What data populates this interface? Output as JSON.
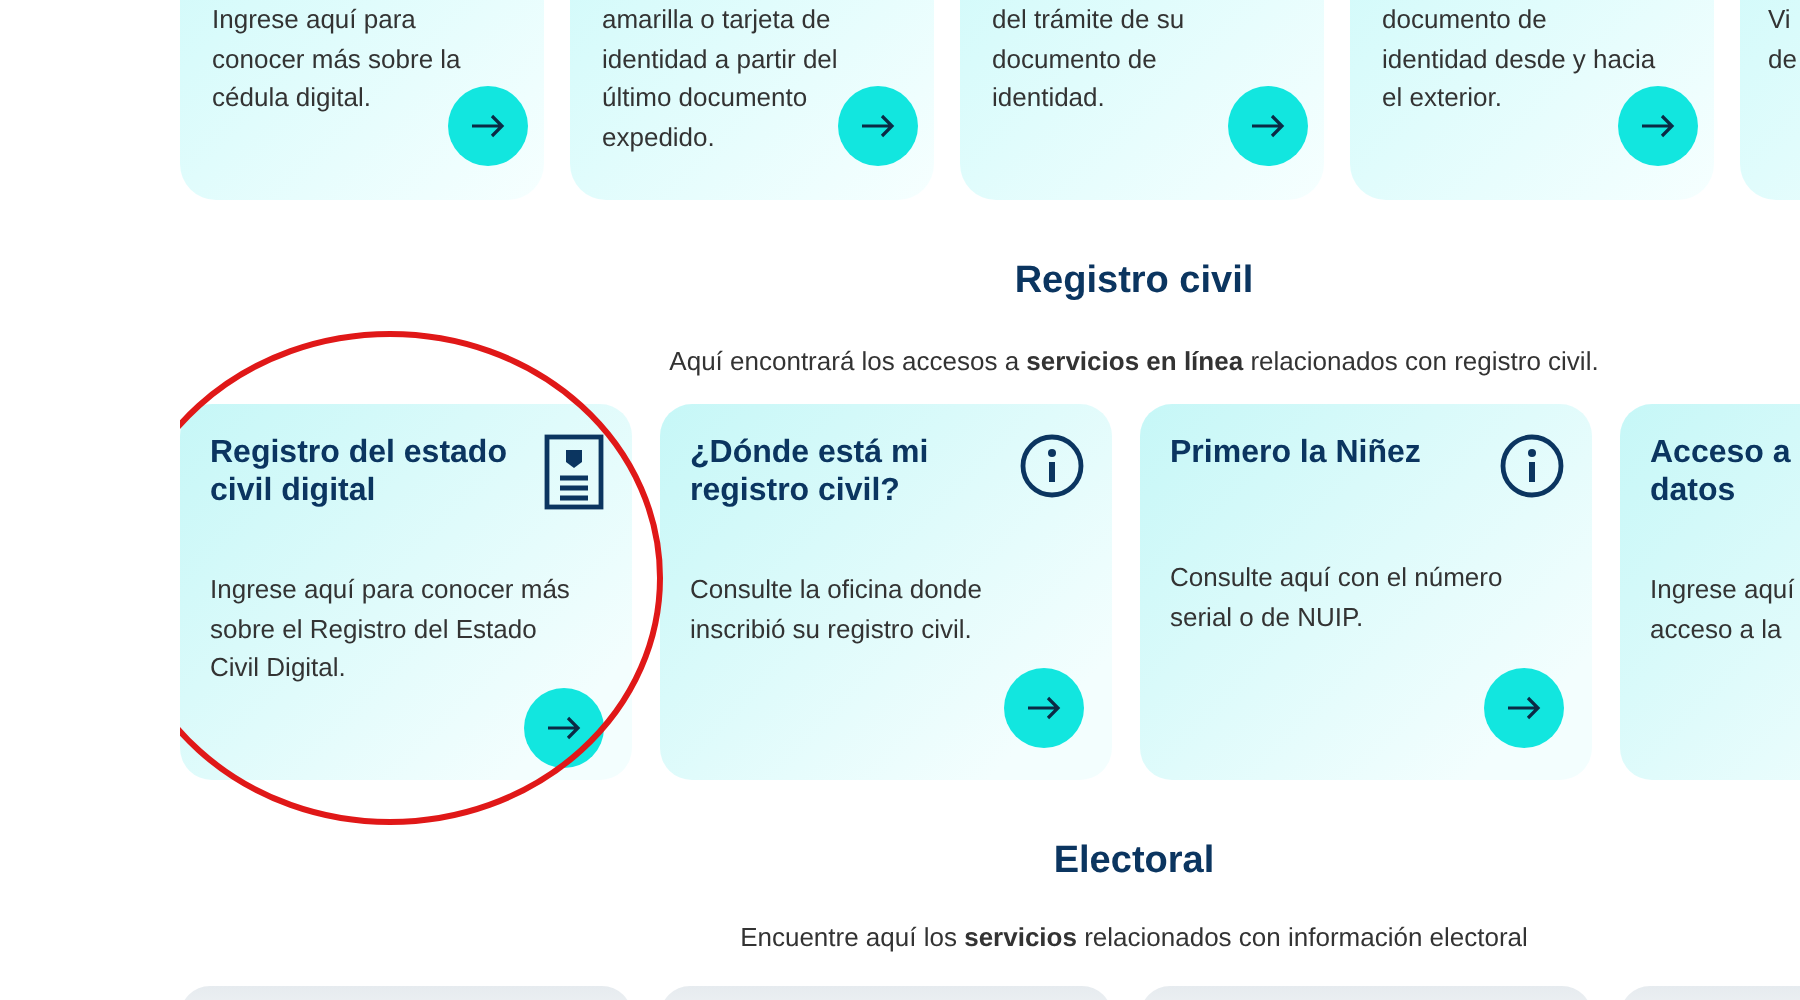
{
  "top_cards": [
    {
      "kind": "body",
      "lines": [
        "Ingrese aquí para",
        "conocer más sobre la",
        "cédula digital."
      ]
    },
    {
      "kind": "body",
      "lines": [
        "amarilla o tarjeta de",
        "identidad a partir del",
        "último documento",
        "expedido."
      ]
    },
    {
      "kind": "body",
      "lines": [
        "del trámite de su",
        "documento de",
        "identidad."
      ]
    },
    {
      "kind": "body",
      "lines": [
        "documento de",
        "identidad desde y hacia",
        "el exterior."
      ]
    },
    {
      "kind": "cut",
      "lines": [
        "Vi",
        "de"
      ]
    }
  ],
  "sections": [
    {
      "title": "Registro civil",
      "intro": "Aquí encontrará los accesos a **servicios en línea** relacionados con registro civil.",
      "cards": [
        {
          "kind": "document",
          "title": "Registro del estado civil digital",
          "lines": [
            "Ingrese aquí para conocer más",
            "sobre el Registro del Estado",
            "Civil Digital."
          ],
          "highlighted": true
        },
        {
          "kind": "info",
          "title": "¿Dónde está mi registro civil?",
          "lines": [
            "Consulte la oficina donde",
            "inscribió su registro civil."
          ],
          "highlighted": false
        },
        {
          "kind": "info",
          "title": "Primero la Niñez",
          "lines": [
            "Consulte aquí con el número",
            "serial o de NUIP."
          ],
          "highlighted": false
        },
        {
          "kind": "cut",
          "title": "Acceso a datos",
          "lines": [
            "Ingrese aquí",
            "acceso a la"
          ],
          "highlighted": false
        }
      ]
    },
    {
      "title": "Electoral",
      "intro": "Encuentre aquí los **servicios** relacionados con información electoral",
      "cards": [
        {
          "kind": "stub"
        },
        {
          "kind": "stub"
        },
        {
          "kind": "stub"
        },
        {
          "kind": "stub"
        }
      ]
    }
  ]
}
